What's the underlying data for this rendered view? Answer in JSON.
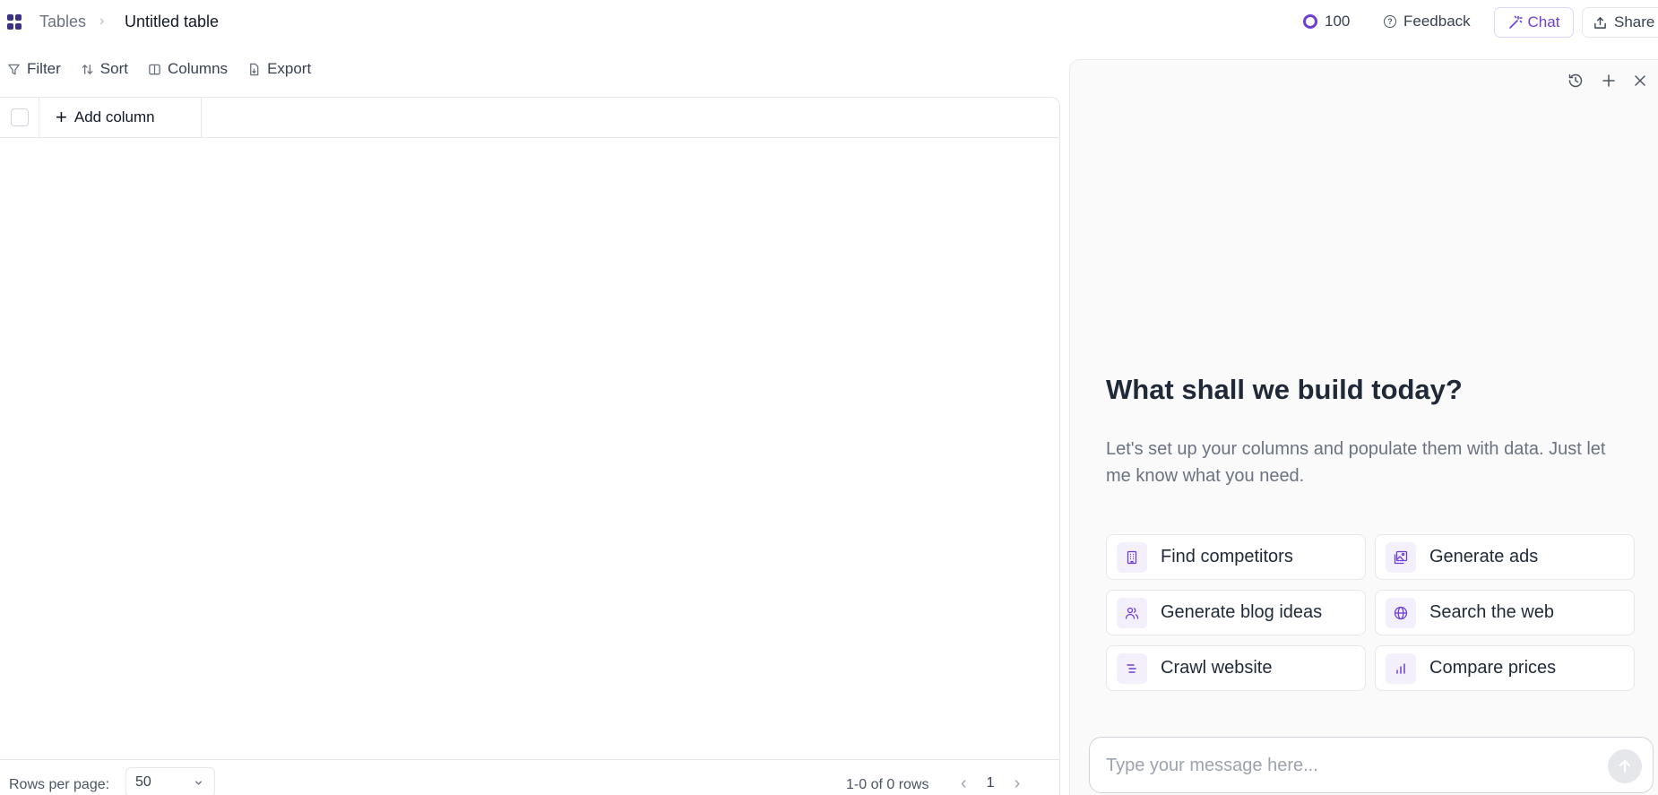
{
  "header": {
    "breadcrumb_root": "Tables",
    "breadcrumb_separator": "›",
    "table_title": "Untitled table",
    "credits": "100",
    "feedback_label": "Feedback",
    "chat_label": "Chat",
    "share_label": "Share"
  },
  "toolbar": {
    "filter_label": "Filter",
    "sort_label": "Sort",
    "columns_label": "Columns",
    "export_label": "Export"
  },
  "table": {
    "add_column_label": "Add column",
    "rows_per_page_label": "Rows per page:",
    "rows_per_page_value": "50",
    "range_text": "1-0 of 0 rows",
    "current_page": "1"
  },
  "chat": {
    "headline": "What shall we build today?",
    "subtext": "Let's set up your columns and populate them with data. Just let me know what you need.",
    "suggestions": [
      {
        "label": "Find competitors",
        "icon": "building-icon"
      },
      {
        "label": "Generate ads",
        "icon": "image-icon"
      },
      {
        "label": "Generate blog ideas",
        "icon": "users-icon"
      },
      {
        "label": "Search the web",
        "icon": "globe-icon"
      },
      {
        "label": "Crawl website",
        "icon": "text-align-icon"
      },
      {
        "label": "Compare prices",
        "icon": "bar-chart-icon"
      }
    ],
    "input_placeholder": "Type your message here..."
  },
  "colors": {
    "accent": "#6d3fd6",
    "app_icon": "#3b3187",
    "icon_tile": "#f3f0fb"
  }
}
